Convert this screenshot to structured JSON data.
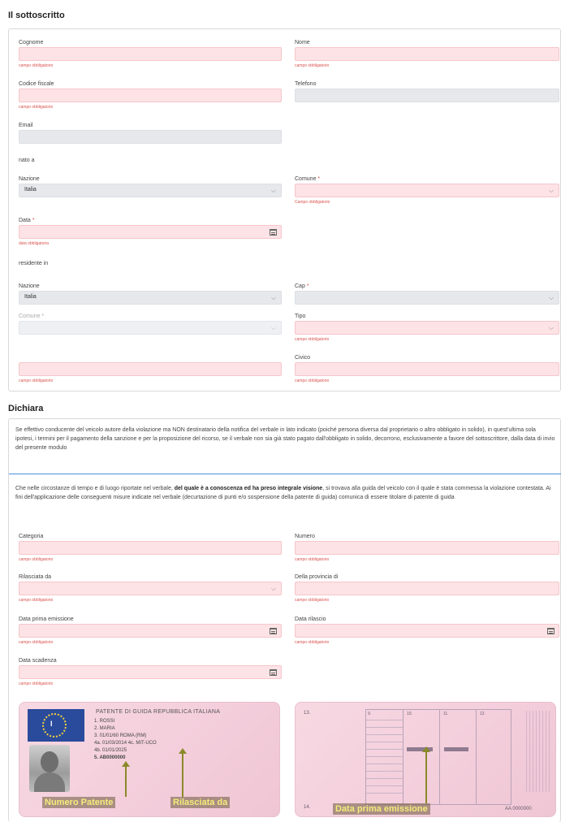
{
  "sections": {
    "sottoscritto_title": "Il sottoscritto",
    "dichiara_title": "Dichiara"
  },
  "sottoscritto": {
    "cognome": {
      "label": "Cognome",
      "error": "campo obbligatorio"
    },
    "nome": {
      "label": "Nome",
      "error": "campo obbligatorio"
    },
    "codice_fiscale": {
      "label": "Codice fiscale",
      "error": "campo obbligatorio"
    },
    "telefono": {
      "label": "Telefono"
    },
    "email": {
      "label": "Email"
    },
    "nato_a": "nato a",
    "nascita_nazione": {
      "label": "Nazione",
      "value": "Italia"
    },
    "nascita_comune": {
      "label": "Comune",
      "required": "*",
      "error": "Campo obbligatorio"
    },
    "nascita_data": {
      "label": "Data",
      "required": "*",
      "error": "data obbligatoria"
    },
    "residente_in": "residente in",
    "res_nazione": {
      "label": "Nazione",
      "value": "Italia"
    },
    "res_cap": {
      "label": "Cap",
      "required": "*"
    },
    "res_comune": {
      "label": "Comune",
      "required": "*"
    },
    "res_tipo": {
      "label": "Tipo",
      "error": "campo obbligatorio"
    },
    "res_civico": {
      "label": "Civico",
      "error": "campo obbligatorio"
    },
    "res_indirizzo": {
      "error": "campo obbligatorio"
    }
  },
  "dichiara": {
    "option1": "Se effettivo conducente del veicolo autore della violazione ma NON destinatario della notifica del verbale in lato indicato (poiché persona diversa dal proprietario o altro obbligato in solido), in quest'ultima sola ipotesi, i termini per il pagamento della sanzione e per la proposizione del ricorso, se il verbale non sia già stato pagato dall'obbligato in solido, decorrono, esclusivamente a favore del sottoscrittore, dalla data di invio del presente modulo",
    "option2_pre": "Che nelle circostanze di tempo e di luogo riportate nel verbale, ",
    "option2_bold": "del quale è a conoscenza ed ha preso integrale visione",
    "option2_post": ", si trovava alla guida del veicolo con il quale è stata commessa la violazione contestata. Ai fini dell'applicazione delle conseguenti misure indicate nel verbale (decurtazione di punti e/o sospensione della patente di guida) comunica di essere titolare di patente di guida"
  },
  "patente": {
    "categoria": {
      "label": "Categoria",
      "error": "campo obbligatorio"
    },
    "numero": {
      "label": "Numero",
      "error": "campo obbligatorio"
    },
    "rilasciata_da": {
      "label": "Rilasciata da",
      "error": "campo obbligatorio"
    },
    "provincia": {
      "label": "Della provincia di",
      "error": "campo obbligatorio"
    },
    "data_prima": {
      "label": "Data prima emissione",
      "error": "campo obbligatorio"
    },
    "data_rilascio": {
      "label": "Data rilascio",
      "error": "campo obbligatorio"
    },
    "data_scadenza": {
      "label": "Data scadenza",
      "error": "campo obbligatorio"
    }
  },
  "card_front": {
    "header": "PATENTE DI GUIDA    REPUBBLICA ITALIANA",
    "eu_letter": "I",
    "line1": "1.  ROSSI",
    "line2": "2.  MARIA",
    "line3": "3.  01/01/60    ROMA     (RM)",
    "line4": "4a. 01/03/2014  4c. MIT-UCO",
    "line5": "4b. 01/01/2025",
    "line6": "5.  AB0000000",
    "callout_numero": "Numero Patente",
    "callout_rilasciata": "Rilasciata da"
  },
  "card_back": {
    "num9": "9.",
    "num10": "10.",
    "num11": "11.",
    "num12": "12.",
    "num13": "13.",
    "num14": "14.",
    "callout_data": "Data prima emissione",
    "serial": "AA 0000000"
  }
}
